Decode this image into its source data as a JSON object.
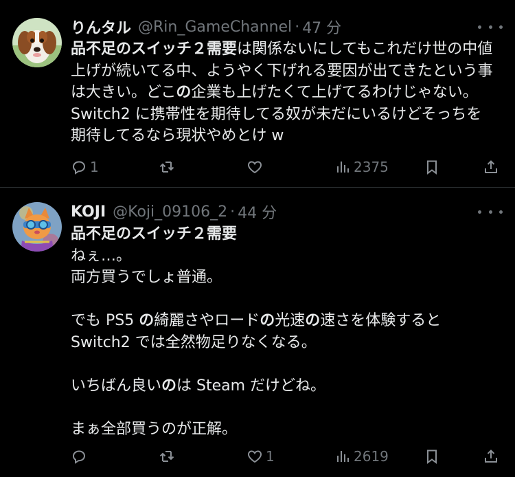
{
  "tweets": [
    {
      "display_name": "りんタル",
      "handle": "@Rin_GameChannel",
      "separator": "·",
      "time": "47 分",
      "lines": [
        [
          {
            "t": "品不足のスイッチ２需要",
            "b": true
          },
          {
            "t": "は関係ないにしてもこれだけ世の中値",
            "b": false
          }
        ],
        [
          {
            "t": "上げが続いてる中、ようやく下げれる要因が出てきたという事",
            "b": false
          }
        ],
        [
          {
            "t": "は大きい。どこ",
            "b": false
          },
          {
            "t": "の",
            "b": true
          },
          {
            "t": "企業も上げたくて上げてるわけじゃない。",
            "b": false
          }
        ],
        [
          {
            "t": "Switch2 に携帯性を期待してる奴が未だにいるけどそっちを",
            "b": false
          }
        ],
        [
          {
            "t": "期待してるなら現状やめとけ w",
            "b": false
          }
        ]
      ],
      "reply_count": "1",
      "retweet_count": "",
      "like_count": "",
      "view_count": "2375",
      "avatar": "dog"
    },
    {
      "display_name": "KOJI",
      "handle": "@Koji_09106_2",
      "separator": "·",
      "time": "44 分",
      "lines": [
        [
          {
            "t": "品不足のスイッチ２需要",
            "b": true
          }
        ],
        [
          {
            "t": "ねぇ…。",
            "b": false
          }
        ],
        [
          {
            "t": "両方買うでしょ普通。",
            "b": false
          }
        ],
        [],
        [
          {
            "t": "でも PS5 ",
            "b": false
          },
          {
            "t": "の",
            "b": true
          },
          {
            "t": "綺麗さやロード",
            "b": false
          },
          {
            "t": "の",
            "b": true
          },
          {
            "t": "光速",
            "b": false
          },
          {
            "t": "の",
            "b": true
          },
          {
            "t": "速さを体験すると",
            "b": false
          }
        ],
        [
          {
            "t": "Switch2 では全然物足りなくなる。",
            "b": false
          }
        ],
        [],
        [
          {
            "t": "いちばん良い",
            "b": false
          },
          {
            "t": "の",
            "b": true
          },
          {
            "t": "は Steam だけどね。",
            "b": false
          }
        ],
        [],
        [
          {
            "t": "まぁ全部買うのが正解。",
            "b": false
          }
        ]
      ],
      "reply_count": "",
      "retweet_count": "",
      "like_count": "1",
      "view_count": "2619",
      "avatar": "cat"
    }
  ],
  "icons": {
    "reply": "reply-icon",
    "retweet": "retweet-icon",
    "like": "heart-icon",
    "views": "views-icon",
    "bookmark": "bookmark-icon",
    "share": "share-icon",
    "more": "more-icon"
  },
  "colors": {
    "background": "#000000",
    "text": "#e7e9ea",
    "muted": "#71767b",
    "divider": "#2f3336"
  }
}
